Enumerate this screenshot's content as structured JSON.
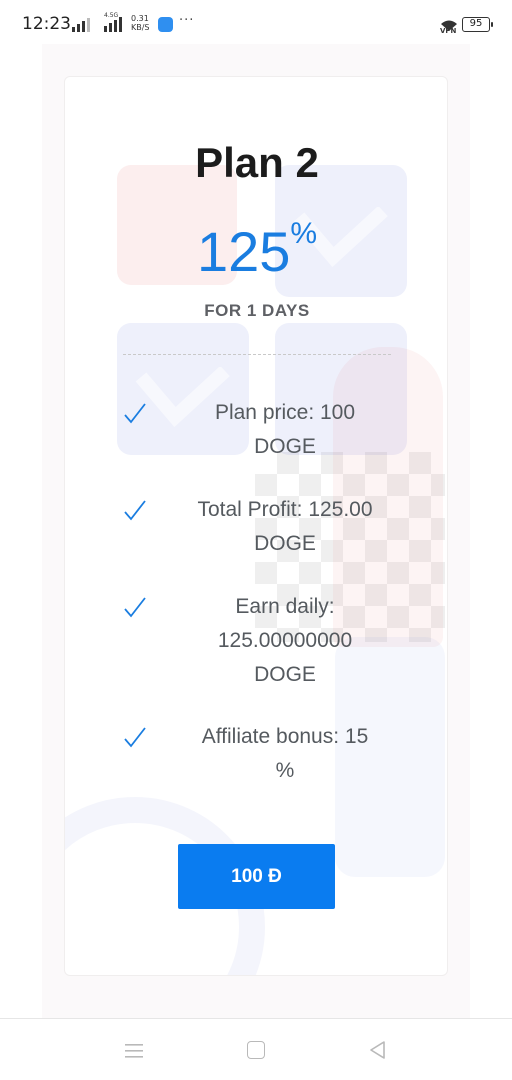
{
  "status_bar": {
    "time": "12:23",
    "network_type": "4.5G",
    "speed_value": "0.31",
    "speed_unit": "KB/S",
    "more": "···",
    "vpn_label": "VPN",
    "battery": "95"
  },
  "plan": {
    "name": "Plan 2",
    "percent_value": "125",
    "percent_sign": "%",
    "duration": "FOR 1 DAYS",
    "features": [
      {
        "icon": "check-icon",
        "line1": "Plan price: 100",
        "line2": "DOGE",
        "line3": ""
      },
      {
        "icon": "check-icon",
        "line1": "Total Profit: 125.00",
        "line2": "DOGE",
        "line3": ""
      },
      {
        "icon": "check-icon",
        "line1": "Earn daily:",
        "line2": "125.00000000",
        "line3": "DOGE"
      },
      {
        "icon": "check-icon",
        "line1": "Affiliate bonus: 15",
        "line2": "%",
        "line3": ""
      }
    ],
    "button_label": "100 Đ"
  },
  "nav_bar": {
    "menu_icon": "menu-icon",
    "home_icon": "home-icon",
    "back_icon": "back-icon"
  },
  "colors": {
    "accent": "#1a7de0",
    "button": "#0a7cf0",
    "text": "#555a5f"
  }
}
